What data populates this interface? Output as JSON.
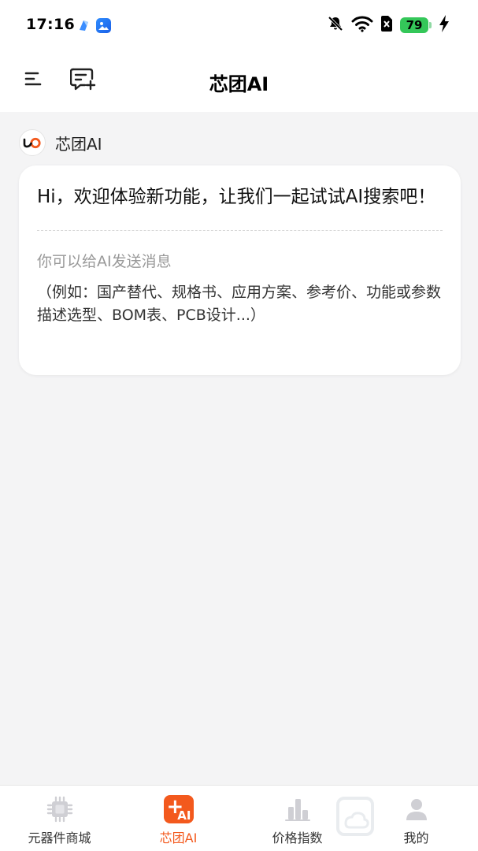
{
  "status_bar": {
    "time": "17:16",
    "battery": "79",
    "icons": [
      "app-icon-1",
      "gallery-app-icon",
      "mute-bell-icon",
      "wifi-icon",
      "no-sim-icon",
      "battery-icon",
      "charging-bolt-icon"
    ]
  },
  "header": {
    "title": "芯团AI",
    "icons": [
      "menu-icon",
      "new-chat-icon"
    ]
  },
  "chat": {
    "bot_name": "芯团AI",
    "greeting": "Hi，欢迎体验新功能，让我们一起试试AI搜索吧！",
    "hint_title": "你可以给AI发送消息",
    "hint_examples": "（例如：国产替代、规格书、应用方案、参考价、功能或参数描述选型、BOM表、PCB设计...）"
  },
  "tabs": [
    {
      "label": "元器件商城",
      "icon": "chip-icon",
      "active": false
    },
    {
      "label": "芯团AI",
      "icon": "ai-plus-icon",
      "active": true
    },
    {
      "label": "价格指数",
      "icon": "bar-chart-icon",
      "active": false
    },
    {
      "label": "我的",
      "icon": "user-icon",
      "active": false
    }
  ],
  "colors": {
    "accent": "#f3591d",
    "battery_green": "#34c759",
    "background": "#f4f4f5",
    "card": "#ffffff",
    "hint_gray": "#999999"
  }
}
